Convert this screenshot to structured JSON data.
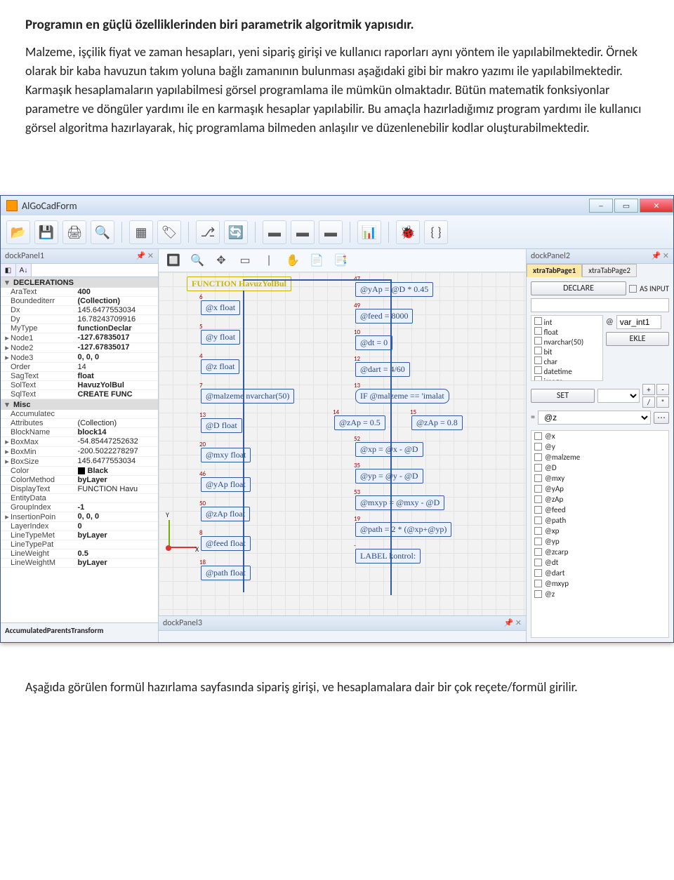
{
  "doc": {
    "h1": "Programın en güçlü özelliklerinden biri parametrik algoritmik yapısıdır.",
    "p1": "Malzeme, işçilik fiyat ve zaman hesapları, yeni sipariş girişi ve kullanıcı raporları aynı yöntem ile yapılabilmektedir. Örnek olarak bir kaba havuzun takım yoluna bağlı zamanının bulunması aşağıdaki gibi bir makro yazımı ile yapılabilmektedir. Karmaşık hesaplamaların yapılabilmesi görsel programlama ile mümkün olmaktadır. Bütün matematik fonksiyonlar parametre ve döngüler yardımı ile en karmaşık hesaplar yapılabilir. Bu amaçla hazırladığımız program yardımı ile kullanıcı görsel algoritma hazırlayarak, hiç programlama bilmeden anlaşılır ve düzenlenebilir kodlar oluşturabilmektedir.",
    "p2": "Aşağıda görülen formül hazırlama sayfasında sipariş girişi, ve hesaplamalara dair bir çok reçete/formül girilir."
  },
  "window": {
    "title": "AlGoCadForm"
  },
  "dockleft": {
    "title": "dockPanel1"
  },
  "dockright": {
    "title": "dockPanel2",
    "tabs": [
      "xtraTabPage1",
      "xtraTabPage2"
    ]
  },
  "dockbottom": {
    "title": "dockPanel3"
  },
  "propgrid": {
    "cat1": "DECLERATIONS",
    "rows1": [
      {
        "k": "AraText",
        "v": "400",
        "b": true
      },
      {
        "k": "Boundediterr",
        "v": "(Collection)",
        "b": true
      },
      {
        "k": "Dx",
        "v": "145.6477553034"
      },
      {
        "k": "Dy",
        "v": "16.78243709916"
      },
      {
        "k": "MyType",
        "v": "functionDeclar",
        "b": true
      },
      {
        "k": "Node1",
        "v": "-127.67835017",
        "b": true,
        "exp": true
      },
      {
        "k": "Node2",
        "v": "-127.67835017",
        "b": true,
        "exp": true
      },
      {
        "k": "Node3",
        "v": "0, 0, 0",
        "b": true,
        "exp": true
      },
      {
        "k": "Order",
        "v": "14"
      },
      {
        "k": "SagText",
        "v": "float",
        "b": true
      },
      {
        "k": "SolText",
        "v": "HavuzYolBul",
        "b": true
      },
      {
        "k": "SqlText",
        "v": "CREATE FUNC",
        "b": true
      }
    ],
    "cat2": "Misc",
    "rows2": [
      {
        "k": "Accumulatec",
        "v": ""
      },
      {
        "k": "Attributes",
        "v": "(Collection)"
      },
      {
        "k": "BlockName",
        "v": "block14",
        "b": true
      },
      {
        "k": "BoxMax",
        "v": "-54.85447252632",
        "exp": true
      },
      {
        "k": "BoxMin",
        "v": "-200.5022278297",
        "exp": true
      },
      {
        "k": "BoxSize",
        "v": "145.6477553034",
        "exp": true
      },
      {
        "k": "Color",
        "v": "Black",
        "b": true,
        "sw": "#000"
      },
      {
        "k": "ColorMethod",
        "v": "byLayer",
        "b": true
      },
      {
        "k": "DisplayText",
        "v": "FUNCTION Havu"
      },
      {
        "k": "EntityData",
        "v": ""
      },
      {
        "k": "GroupIndex",
        "v": "-1",
        "b": true
      },
      {
        "k": "InsertionPoin",
        "v": "0, 0, 0",
        "b": true,
        "exp": true
      },
      {
        "k": "LayerIndex",
        "v": "0",
        "b": true
      },
      {
        "k": "LineTypeMet",
        "v": "byLayer",
        "b": true
      },
      {
        "k": "LineTypePat",
        "v": ""
      },
      {
        "k": "LineWeight",
        "v": "0.5",
        "b": true
      },
      {
        "k": "LineWeightM",
        "v": "byLayer",
        "b": true
      }
    ],
    "desc": "AccumulatedParentsTransform"
  },
  "rightpanel": {
    "declare": "DECLARE",
    "asinput": "AS INPUT",
    "types": [
      "int",
      "float",
      "nvarchar(50)",
      "bit",
      "char",
      "datetime",
      "image"
    ],
    "atlabel": "@",
    "varname": "var_int1",
    "ekle": "EKLE",
    "set": "SET",
    "ops": [
      "+",
      "-",
      "/",
      "*"
    ],
    "eq": "=",
    "eqval": "@z",
    "vars": [
      "@x",
      "@y",
      "@malzeme",
      "@D",
      "@mxy",
      "@yAp",
      "@zAp",
      "@feed",
      "@path",
      "@xp",
      "@yp",
      "@zcarp",
      "@dt",
      "@dart",
      "@mxyp",
      "@z"
    ]
  },
  "flow": {
    "left": [
      {
        "t": "@x float",
        "n": "6"
      },
      {
        "t": "@y float",
        "n": "5"
      },
      {
        "t": "@z float",
        "n": "4"
      },
      {
        "t": "@malzeme nvarchar(50)",
        "n": "7"
      },
      {
        "t": "@D float",
        "n": "13"
      },
      {
        "t": "@mxy float",
        "n": "20"
      },
      {
        "t": "@yAp float",
        "n": "46"
      },
      {
        "t": "@zAp float",
        "n": "50"
      },
      {
        "t": "@feed float",
        "n": "8"
      },
      {
        "t": "@path float",
        "n": "18"
      }
    ],
    "right": [
      {
        "t": "@yAp = @D * 0.45",
        "n": "47"
      },
      {
        "t": "@feed = 8000",
        "n": "49"
      },
      {
        "t": "@dt = 0",
        "n": "10"
      },
      {
        "t": "@dart = 4/60",
        "n": "12"
      },
      {
        "t": "IF @malzeme == 'imalat",
        "n": "13",
        "diamond": true
      },
      {
        "t": "@zAp = 0.5",
        "n": "14",
        "half": "l"
      },
      {
        "t": "@zAp = 0.8",
        "n": "15",
        "half": "r"
      },
      {
        "t": "@xp = @x - @D",
        "n": "52"
      },
      {
        "t": "@yp = @y - @D",
        "n": "35"
      },
      {
        "t": "@mxyp = @mxy - @D",
        "n": "53"
      },
      {
        "t": "@path = 2 * (@xp+@yp)",
        "n": "19"
      },
      {
        "t": "LABEL kontrol:",
        "n": "-"
      }
    ],
    "title": "FUNCTION HavuzYolBul"
  }
}
